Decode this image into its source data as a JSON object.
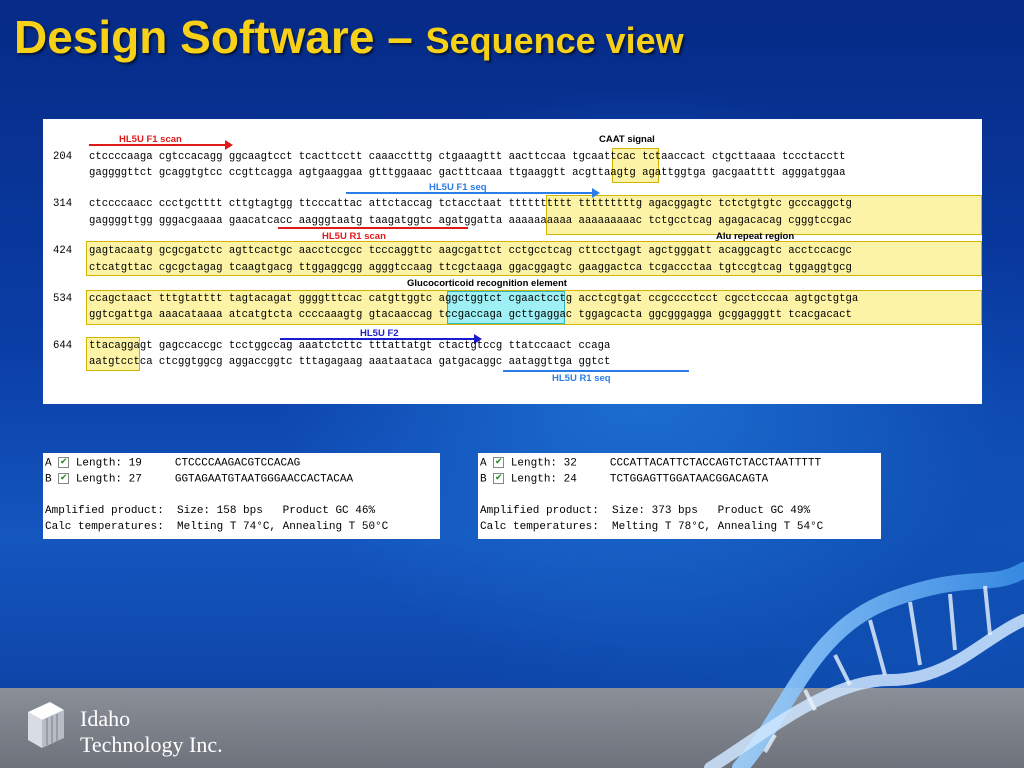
{
  "slide": {
    "title_main": "Design Software – ",
    "title_sub": "Sequence view"
  },
  "sequence_view": {
    "blocks": [
      {
        "pos": "204",
        "top": "ctccccaaga cgtccacagg ggcaagtcct tcacttcctt caaacctttg ctgaaagttt aacttccaa tgcaattcac tctaaccact ctgcttaaaa tccctacctt",
        "bottom": "gaggggttct gcaggtgtcc ccgttcagga agtgaaggaa gtttggaaac gactttcaaa ttgaaggtt acgttaagtg agattggtga gacgaatttt agggatggaa"
      },
      {
        "pos": "314",
        "top": "ctccccaacc ccctgctttt cttgtagtgg ttcccattac attctaccag tctacctaat tttttttttt tttttttttg agacggagtc tctctgtgtc gcccaggctg",
        "bottom": "gaggggttgg gggacgaaaa gaacatcacc aagggtaatg taagatggtc agatggatta aaaaaaaaaa aaaaaaaaac tctgcctcag agagacacag cgggtccgac"
      },
      {
        "pos": "424",
        "top": "gagtacaatg gcgcgatctc agttcactgc aacctccgcc tcccaggttc aagcgattct cctgcctcag cttcctgagt agctgggatt acaggcagtc acctccacgc",
        "bottom": "ctcatgttac cgcgctagag tcaagtgacg ttggaggcgg agggtccaag ttcgctaaga ggacggagtc gaaggactca tcgaccctaa tgtccgtcag tggaggtgcg"
      },
      {
        "pos": "534",
        "top": "ccagctaact tttgtatttt tagtacagat ggggtttcac catgttggtc aggctggtct cgaactcctg acctcgtgat ccgcccctcct cgcctcccaa agtgctgtga",
        "bottom": "ggtcgattga aaacataaaa atcatgtcta ccccaaagtg gtacaaccag tccgaccaga gcttgaggac tggagcacta ggcgggagga gcggagggtt tcacgacact"
      },
      {
        "pos": "644",
        "top": "ttacaggagt gagccaccgc tcctggccag aaatctcttc tttattatgt ctactgtccg ttatccaact ccaga",
        "bottom": "aatgtcctca ctcggtggcg aggaccggtc tttagagaag aaataataca gatgacaggc aataggttga ggtct"
      }
    ],
    "labels": {
      "f1_scan": "HL5U F1 scan",
      "caat": "CAAT signal",
      "f1_seq": "HL5U F1 seq",
      "r1_scan": "HL5U R1 scan",
      "alu": "Alu repeat region",
      "gre": "Glucocorticoid recognition element",
      "f2": "HL5U F2",
      "r1_seq": "HL5U R1 seq"
    },
    "colors": {
      "highlight_yellow": "#fdf3a6",
      "highlight_cyan": "#9ef0f4",
      "arrow_red": "#e01a1a",
      "arrow_blue": "#2b7de8",
      "arrow_navy": "#1b1bd0"
    }
  },
  "primer_box_1": {
    "a": {
      "id": "A",
      "length": "Length: 19",
      "seq": "CTCCCCAAGACGTCCACAG"
    },
    "b": {
      "id": "B",
      "length": "Length: 27",
      "seq": "GGTAGAATGTAATGGGAACCACTACAA"
    },
    "amp": "Amplified product:  Size: 158 bps   Product GC 46%",
    "temp": "Calc temperatures:  Melting T 74°C, Annealing T 50°C"
  },
  "primer_box_2": {
    "a": {
      "id": "A",
      "length": "Length: 32",
      "seq": "CCCATTACATTCTACCAGTCTACCTAATTTTT"
    },
    "b": {
      "id": "B",
      "length": "Length: 24",
      "seq": "TCTGGAGTTGGATAACGGACAGTA"
    },
    "amp": "Amplified product:  Size: 373 bps   Product GC 49%",
    "temp": "Calc temperatures:  Melting T 78°C, Annealing T 54°C"
  },
  "footer": {
    "company_line1": "Idaho",
    "company_line2": "Technology Inc."
  }
}
